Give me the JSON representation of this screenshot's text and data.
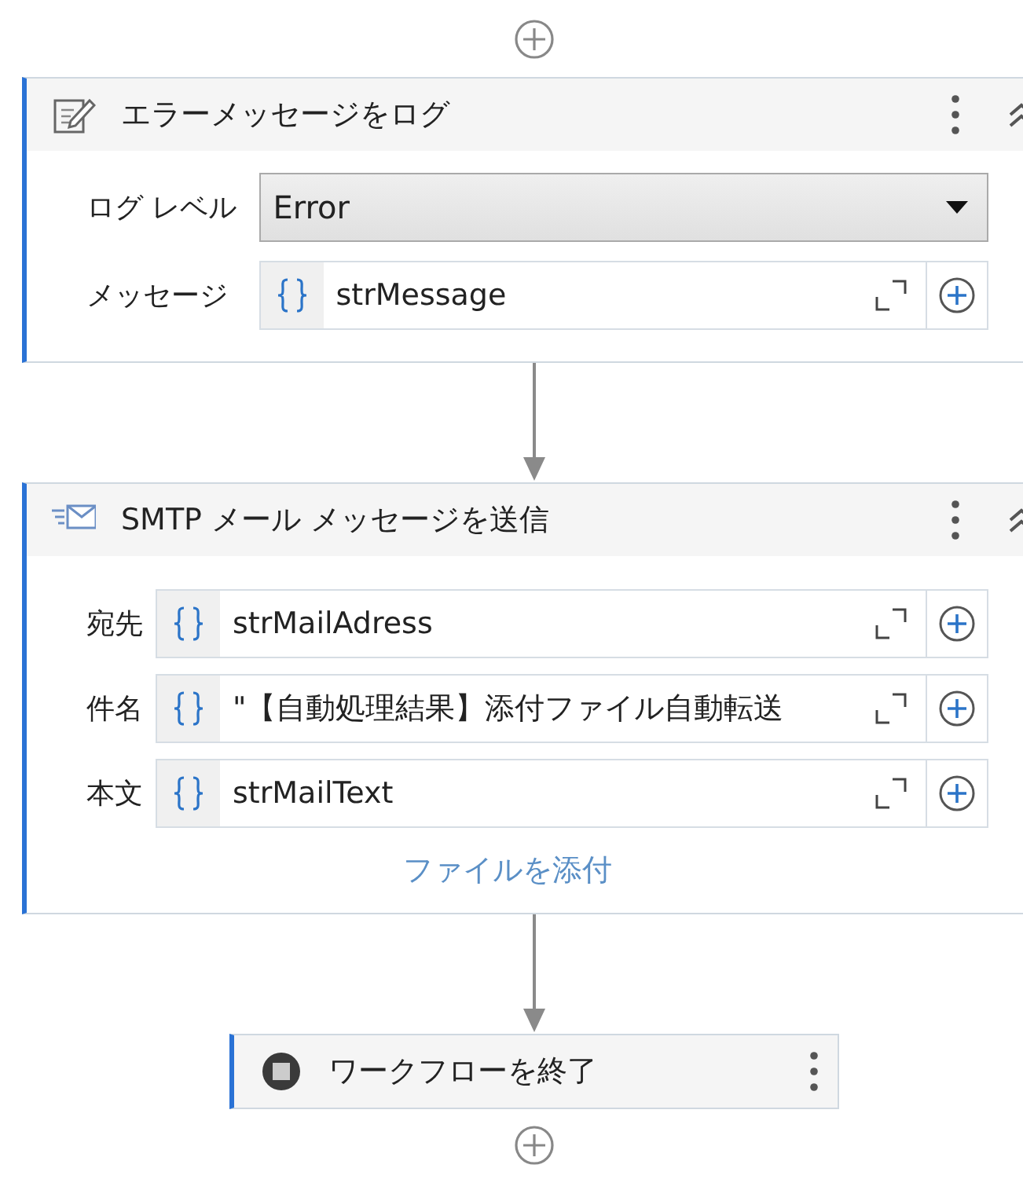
{
  "activities": [
    {
      "kind": "log",
      "title": "エラーメッセージをログ",
      "selected": true,
      "fields": [
        {
          "kind": "dropdown",
          "label": "ログ レベル",
          "value": "Error"
        },
        {
          "kind": "expression",
          "label": "メッセージ",
          "value": "strMessage"
        }
      ]
    },
    {
      "kind": "mail",
      "title": "SMTP メール メッセージを送信",
      "selected": true,
      "fields": [
        {
          "kind": "expression",
          "label": "宛先",
          "value": "strMailAdress"
        },
        {
          "kind": "expression",
          "label": "件名",
          "value": "\"【自動処理結果】添付ファイル自動転送"
        },
        {
          "kind": "expression",
          "label": "本文",
          "value": "strMailText"
        }
      ],
      "link": "ファイルを添付"
    },
    {
      "kind": "end",
      "title": "ワークフローを終了",
      "selected": true
    }
  ]
}
